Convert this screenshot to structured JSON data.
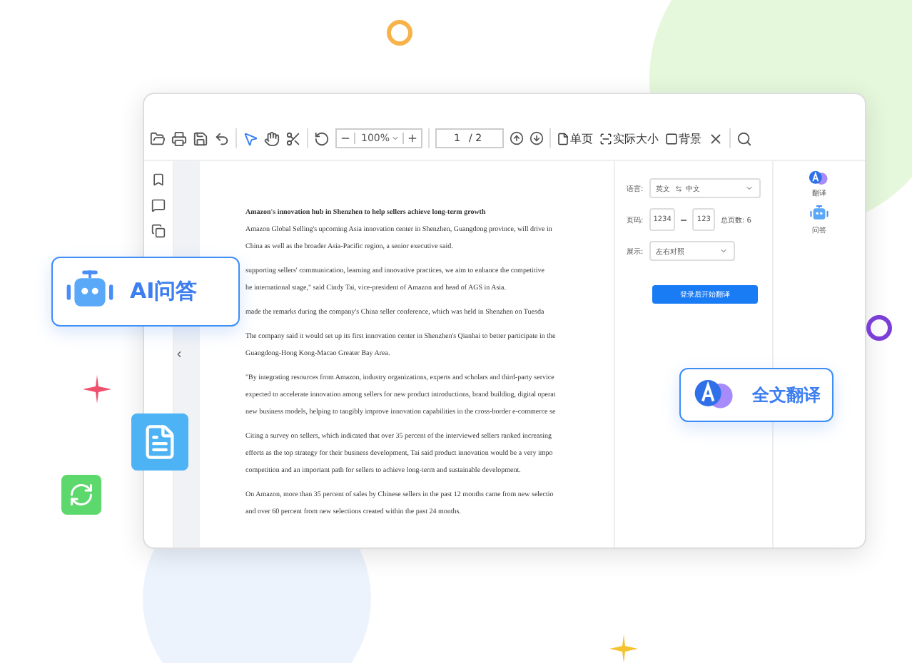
{
  "toolbar": {
    "zoom": "100%",
    "page": "1",
    "page_total": "/ 2",
    "buttons": [
      {
        "label": "单页",
        "kind": "page"
      },
      {
        "label": "实际大小",
        "kind": "size"
      },
      {
        "label": "背景",
        "kind": "background"
      }
    ]
  },
  "document": {
    "title": "Amazon's innovation hub in Shenzhen to help sellers achieve long-term growth",
    "paragraphs": [
      [
        "Amazon Global Selling's upcoming Asia innovation center in Shenzhen, Guangdong province, will drive in",
        "China as well as the broader Asia-Pacific region, a senior executive said."
      ],
      [
        "supporting sellers' communication, learning and innovative practices, we aim to enhance the competitive",
        "he international stage,\" said Cindy Tai, vice-president of Amazon and head of AGS in Asia."
      ],
      [
        "made the remarks during the company's China seller conference, which was held in Shenzhen on Tuesda"
      ],
      [
        "The company said it would set up its first innovation center in Shenzhen's Qianhai to better participate in the",
        "Guangdong-Hong Kong-Macao Greater Bay Area."
      ],
      [
        "\"By integrating resources from Amazon, industry organizations, experts and scholars and third-party service",
        "expected to accelerate innovation among sellers for new product introductions, brand building, digital operat",
        "new business models, helping to tangibly improve innovation capabilities in the cross-border e-commerce se"
      ],
      [
        "Citing a survey on sellers, which indicated that over 35 percent of the interviewed sellers ranked increasing",
        "efforts as the top strategy for their business development, Tai said product innovation would be a very impo",
        "competition and an important path for sellers to achieve long-term and sustainable development."
      ],
      [
        "On Amazon, more than 35 percent of sales by Chinese sellers in the past 12 months came from new selectio",
        "and over 60 percent from new selections created within the past 24 months."
      ]
    ]
  },
  "translate_panel": {
    "language_label": "语言:",
    "source": "英文",
    "target": "中文",
    "pages_label": "页码:",
    "page_from": "1234",
    "page_to": "123",
    "total_pages": "总页数: 6",
    "display_label": "展示:",
    "display_value": "左右对照",
    "button": "登录后开始翻译"
  },
  "side_tabs": [
    {
      "label": "翻译",
      "kind": "translate"
    },
    {
      "label": "问答",
      "kind": "qa"
    }
  ],
  "badges": [
    {
      "label": "AI问答",
      "kind": "qa"
    },
    {
      "label": "全文翻译",
      "kind": "translate"
    }
  ]
}
